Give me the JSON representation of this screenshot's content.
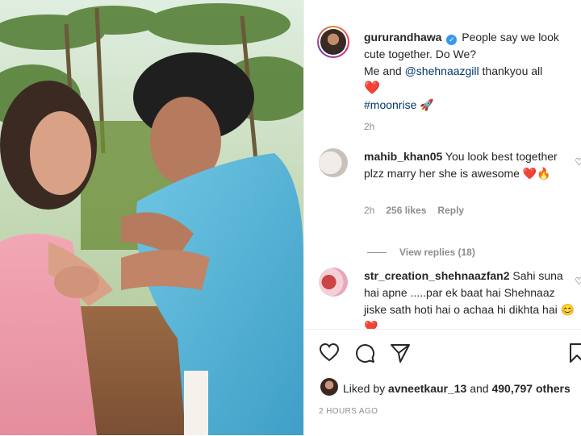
{
  "post": {
    "author": "gururandhawa",
    "caption_line1": "People say we look cute together. Do We?",
    "caption_line2_pre": "Me and ",
    "mention": "@shehnaazgill",
    "caption_line2_post": " thankyou all",
    "heart": "❤️",
    "hashtag": "#moonrise",
    "rocket": "🚀",
    "time": "2h"
  },
  "comments": [
    {
      "user": "mahib_khan05",
      "text": "You look best together plzz marry her she is awesome",
      "emojis": "❤️🔥",
      "time": "2h",
      "likes": "256 likes",
      "reply": "Reply",
      "view_replies": "View replies (18)"
    },
    {
      "user": "str_creation_shehnaazfan2",
      "text": "Sahi suna hai apne .....par ek baat hai Shehnaaz jiske sath hoti hai o achaa hi dikhta hai",
      "emojis": "😊❤️"
    }
  ],
  "footer": {
    "liked_by_prefix": "Liked by ",
    "liked_user": "avneetkaur_13",
    "and": " and ",
    "others": "490,797 others",
    "timestamp": "2 HOURS AGO"
  },
  "icons": [
    "heart-icon",
    "comment-icon",
    "share-icon",
    "bookmark-icon",
    "verified-badge-icon"
  ],
  "colors": {
    "link": "#00376b",
    "muted": "#8e8e8e",
    "verified": "#3897f0",
    "heart": "#ed1c24"
  }
}
